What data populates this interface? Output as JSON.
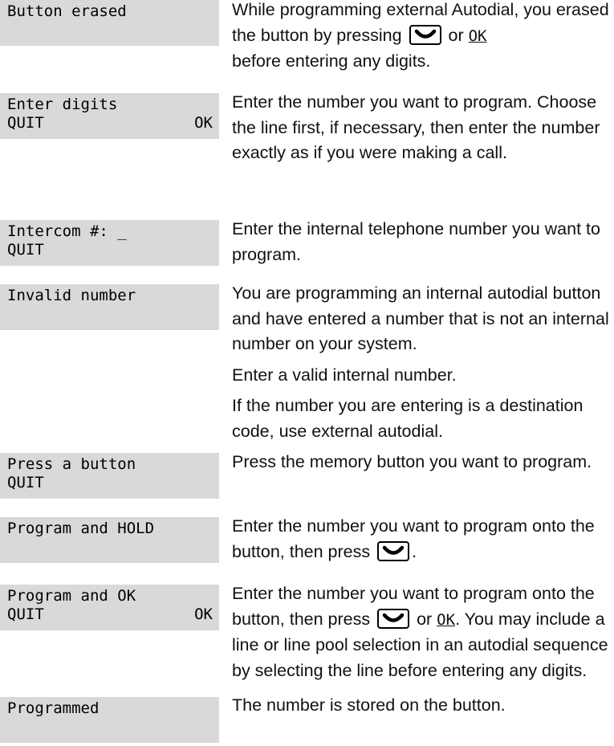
{
  "entries": [
    {
      "display_line1": "Button erased",
      "display_line2": "",
      "soft_left": "",
      "soft_right": "",
      "desc_parts": [
        "While programming external Autodial, you erased the button by pressing ",
        " or ",
        " before entering any digits."
      ],
      "ok_label": "OK"
    },
    {
      "display_line1": "Enter digits",
      "soft_left": "QUIT",
      "soft_right": "OK",
      "desc": "Enter the number you want to program. Choose the line first, if necessary, then enter the number exactly as if you were making a call."
    },
    {
      "display_line1": "Intercom #: _",
      "soft_left": "QUIT",
      "soft_right": "",
      "desc": "Enter the internal telephone number you want to program."
    },
    {
      "display_line1": "Invalid number",
      "desc_paragraphs": [
        "You are programming an internal autodial button and have entered a number that is not an internal number on your system.",
        "Enter a valid internal number.",
        "If the number you are entering is a destination code, use external autodial."
      ]
    },
    {
      "display_line1": "Press a button",
      "soft_left": "QUIT",
      "desc": "Press the memory button you want to program."
    },
    {
      "display_line1": "Program and HOLD",
      "desc_parts": [
        "Enter the number you want to program onto the button, then press ",
        "."
      ]
    },
    {
      "display_line1": "Program and OK",
      "soft_left": "QUIT",
      "soft_right": "OK",
      "desc_parts": [
        "Enter the number you want to program onto the button, then press ",
        " or ",
        ". You may include a line or line pool selection in an autodial sequence by selecting the line before entering any digits."
      ],
      "ok_label": "OK"
    },
    {
      "display_line1": "Programmed",
      "desc": "The number is stored on the button."
    }
  ],
  "icons": {
    "hold_key": "hold-key-icon"
  }
}
